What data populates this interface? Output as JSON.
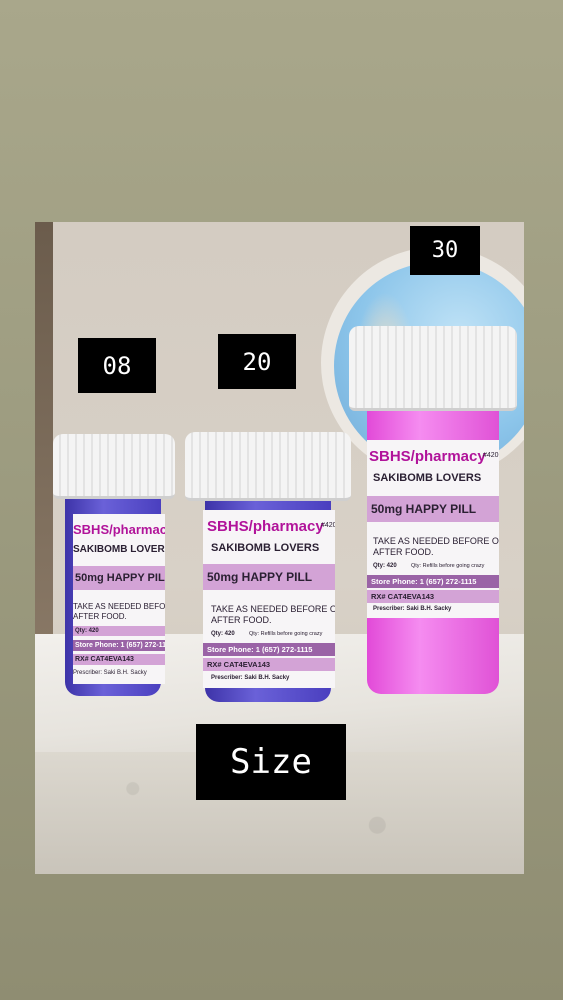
{
  "size_tags": {
    "small": "08",
    "medium": "20",
    "large": "30",
    "caption": "Size"
  },
  "label": {
    "pharmacy": "SBHS/pharmacy",
    "store_num": "#420",
    "patient": "SAKIBOMB LOVERS",
    "drug": "50mg HAPPY PILL",
    "directions_1": "TAKE AS NEEDED BEFORE OR",
    "directions_2": "AFTER FOOD.",
    "qty": "Qty: 420",
    "refills": "Qty: Refills before going crazy",
    "phone": "Store Phone: 1 (657) 272-1115",
    "rx": "RX#  CAT4EVA143",
    "prescriber": "Prescriber: Saki B.H. Sacky"
  },
  "colors": {
    "small_bottle": "#4a3fbf",
    "medium_bottle": "#4a3fbf",
    "large_bottle": "#e24ad8",
    "label_accent": "#b1139a",
    "tag_background": "#000000"
  }
}
